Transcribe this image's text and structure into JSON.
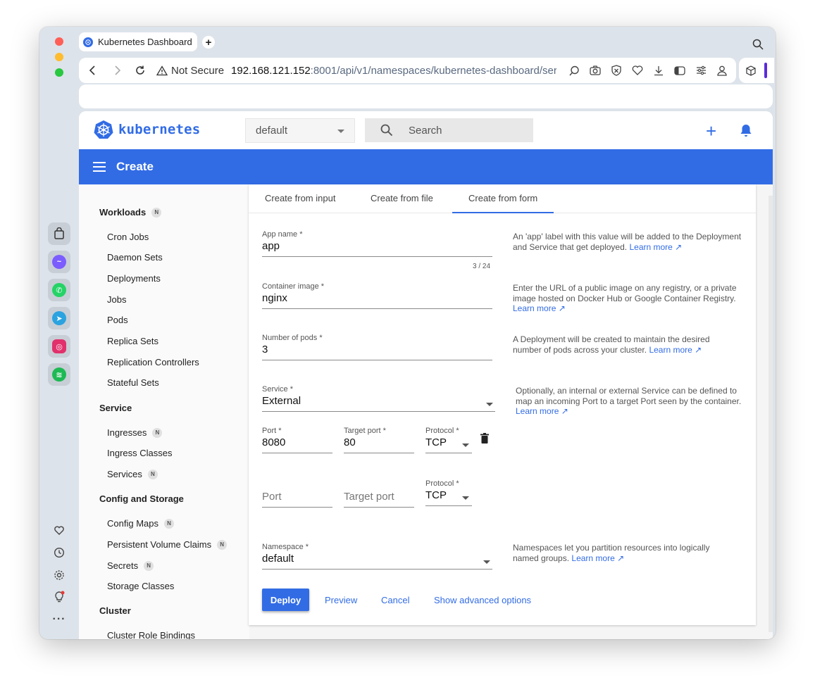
{
  "browser": {
    "tab_title": "Kubernetes Dashboard",
    "security_label": "Not Secure",
    "url_host": "192.168.121.152",
    "url_rest": ":8001/api/v1/namespaces/kubernetes-dashboard/serv"
  },
  "header": {
    "logo_text": "kubernetes",
    "namespace_selected": "default",
    "search_placeholder": "Search"
  },
  "titlebar": {
    "title": "Create"
  },
  "sidebar": {
    "workloads": "Workloads",
    "workload_items": [
      "Cron Jobs",
      "Daemon Sets",
      "Deployments",
      "Jobs",
      "Pods",
      "Replica Sets",
      "Replication Controllers",
      "Stateful Sets"
    ],
    "service": "Service",
    "service_items": [
      "Ingresses",
      "Ingress Classes",
      "Services"
    ],
    "config": "Config and Storage",
    "config_items": [
      "Config Maps",
      "Persistent Volume Claims",
      "Secrets",
      "Storage Classes"
    ],
    "cluster": "Cluster",
    "cluster_items": [
      "Cluster Role Bindings"
    ],
    "badge": "N"
  },
  "tabs": [
    "Create from input",
    "Create from file",
    "Create from form"
  ],
  "form": {
    "app_name_label": "App name *",
    "app_name_value": "app",
    "app_name_counter": "3 / 24",
    "container_image_label": "Container image *",
    "container_image_value": "nginx",
    "pods_label": "Number of pods *",
    "pods_value": "3",
    "service_label": "Service *",
    "service_value": "External",
    "port_label": "Port *",
    "port_value": "8080",
    "target_port_label": "Target port *",
    "target_port_value": "80",
    "protocol_label": "Protocol *",
    "protocol_value": "TCP",
    "port_placeholder": "Port",
    "target_port_placeholder": "Target port",
    "protocol2_label": "Protocol *",
    "protocol2_value": "TCP",
    "namespace_label": "Namespace *",
    "namespace_value": "default"
  },
  "help": {
    "app_name": "An 'app' label with this value will be added to the Deployment and Service that get deployed.",
    "container_image": "Enter the URL of a public image on any registry, or a private image hosted on Docker Hub or Google Container Registry.",
    "pods": "A Deployment will be created to maintain the desired number of pods across your cluster.",
    "service": "Optionally, an internal or external Service can be defined to map an incoming Port to a target Port seen by the container.",
    "namespace": "Namespaces let you partition resources into logically named groups.",
    "learn_more": "Learn more"
  },
  "actions": {
    "deploy": "Deploy",
    "preview": "Preview",
    "cancel": "Cancel",
    "advanced": "Show advanced options"
  }
}
